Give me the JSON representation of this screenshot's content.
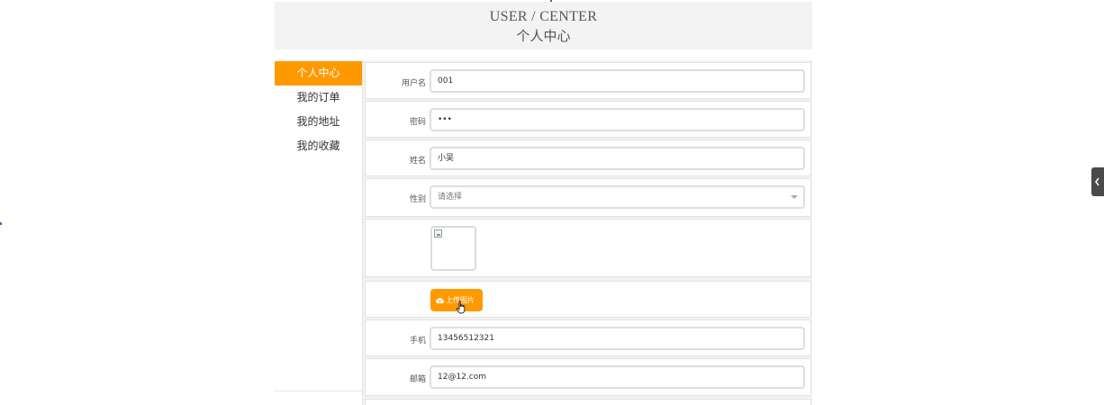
{
  "header": {
    "title_en": "USER / CENTER",
    "title_cn": "个人中心"
  },
  "sidebar": {
    "items": [
      {
        "label": "个人中心",
        "active": true
      },
      {
        "label": "我的订单",
        "active": false
      },
      {
        "label": "我的地址",
        "active": false
      },
      {
        "label": "我的收藏",
        "active": false
      }
    ]
  },
  "form": {
    "username": {
      "label": "用户名",
      "value": "001"
    },
    "password": {
      "label": "密码",
      "value": "•••"
    },
    "name": {
      "label": "姓名",
      "value": "小吴"
    },
    "gender": {
      "label": "性别",
      "placeholder": "请选择"
    },
    "avatar": {
      "alt": ""
    },
    "upload": {
      "label": "上传图片",
      "icon": "cloud-upload-icon"
    },
    "phone": {
      "label": "手机",
      "value": "13456512321"
    },
    "email": {
      "label": "邮箱",
      "value": "12@12.com"
    }
  },
  "colors": {
    "accent": "#ff9900",
    "header_bg": "#f3f3f3",
    "form_bg": "#f2f2f2"
  }
}
